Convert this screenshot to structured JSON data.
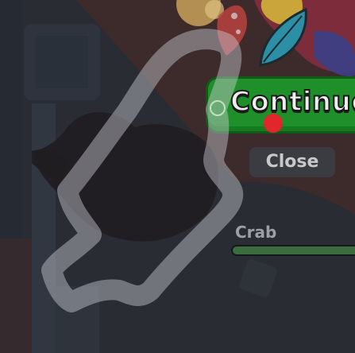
{
  "dialog": {
    "continue_label": "Continue",
    "close_label": "Close"
  },
  "monster": {
    "name": "Crab",
    "progress": 1.0
  },
  "colors": {
    "continue_green": "#1f8f2a",
    "close_gray": "#3a3c42",
    "overlay_dark": "#2a2c33",
    "cursor_red": "#e3262b",
    "progress_green": "#3c6b3e"
  },
  "icons": {
    "leaf": "leaf-icon",
    "cursor": "cursor-dot-icon",
    "path": "swipe-path-icon"
  }
}
